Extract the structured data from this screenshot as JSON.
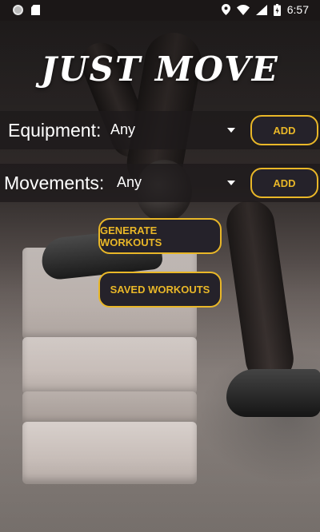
{
  "status_bar": {
    "time": "6:57",
    "icons": [
      "notification-dot-icon",
      "sd-card-icon",
      "location-icon",
      "wifi-icon",
      "signal-icon",
      "battery-charging-icon"
    ]
  },
  "app": {
    "title": "JUST MOVE"
  },
  "equipment": {
    "label": "Equipment:",
    "selected": "Any",
    "add_label": "ADD"
  },
  "movements": {
    "label": "Movements:",
    "selected": "Any",
    "add_label": "ADD"
  },
  "actions": {
    "generate_label": "GENERATE WORKOUTS",
    "saved_label": "SAVED WORKOUTS"
  },
  "colors": {
    "accent": "#e9b728",
    "button_bg": "#25222a",
    "band_bg": "#1e1a1b"
  }
}
